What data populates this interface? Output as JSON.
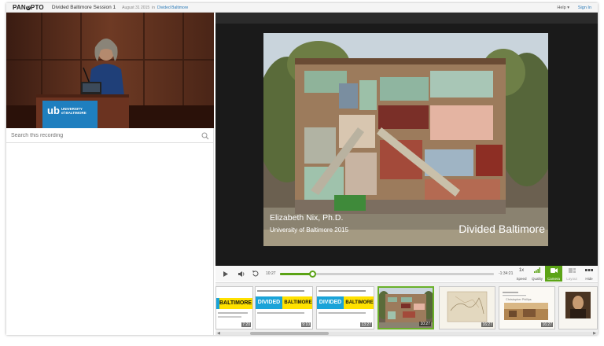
{
  "header": {
    "logo_text": "PAN",
    "logo_o": "O",
    "logo_text_end": "PTO",
    "session_title": "Divided Baltimore Session 1",
    "date": "August 31 2015",
    "in_text": "in",
    "folder_link": "Divided Baltimore",
    "help_label": "Help ▾",
    "signin_label": "Sign In"
  },
  "speaker_video": {
    "podium_logo": "ub",
    "podium_text_1": "UNIVERSITY",
    "podium_text_2": "of BALTIMORE"
  },
  "search": {
    "placeholder": "Search this recording"
  },
  "slide": {
    "name_line": "Elizabeth Nix, Ph.D.",
    "org_line": "University of Baltimore 2015",
    "title_line": "Divided Baltimore"
  },
  "controls": {
    "elapsed": "10:27",
    "remaining": "-1:34:21",
    "speed_value": "1x",
    "speed_label": "Speed",
    "quality_label": "Quality",
    "camera_label": "Camera",
    "layout_label": "Layout",
    "hide_label": "Hide",
    "progress_percent": 15
  },
  "thumbnails": [
    {
      "timestamp": "7:20",
      "kind": "divided"
    },
    {
      "timestamp": "9:10",
      "kind": "divided"
    },
    {
      "timestamp": "13:27",
      "kind": "divided"
    },
    {
      "timestamp": "10:27",
      "kind": "building",
      "active": true
    },
    {
      "timestamp": "16:27",
      "kind": "map"
    },
    {
      "timestamp": "16:27",
      "kind": "painting"
    },
    {
      "timestamp": "",
      "kind": "portrait"
    }
  ],
  "thumb_texts": {
    "divided_a": "DIVIDED",
    "divided_b": "BALTIMORE",
    "painting_caption": "Christopher Phillips"
  },
  "colors": {
    "accent_green": "#5ba316",
    "link_blue": "#2a7ab8",
    "podium_blue": "#1f7fbf"
  }
}
